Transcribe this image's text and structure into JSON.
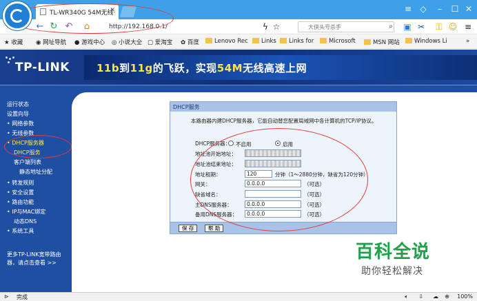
{
  "browser": {
    "tab_title": "TL-WR340G 54M无线·",
    "url": "http://192.168.0.1/",
    "search_placeholder": "大侠头号杀手",
    "status": "完成",
    "zoom": "100%",
    "bookmarks": [
      "收藏",
      "网址导航",
      "游戏中心",
      "小说大全",
      "爱淘宝",
      "百度",
      "Lenovo Rec",
      "Links",
      "Links for",
      "Microsoft",
      "MSN 网站",
      "Windows Li"
    ]
  },
  "brand": {
    "logo_text": "TP-LINK",
    "slogan_a": "11b",
    "slogan_b": "到",
    "slogan_c": "11g",
    "slogan_d": "的飞跃，实现",
    "slogan_e": "54M",
    "slogan_f": "无线高速上网"
  },
  "sidebar": {
    "items": [
      "运行状态",
      "设置向导",
      "• 网络参数",
      "• 无线参数",
      "• DHCP服务器",
      "DHCP服务",
      "客户端列表",
      "静态地址分配",
      "• 转发规则",
      "• 安全设置",
      "• 路由功能",
      "• IP与MAC绑定",
      "动态DNS",
      "• 系统工具"
    ],
    "more_line1": "更多TP-LINK宽带路由",
    "more_line2": "器，请点击查看 >>"
  },
  "panel": {
    "title": "DHCP服务",
    "intro": "本路由器内建DHCP服务器，它能自动替您配置局域网中各计算机的TCP/IP协议。",
    "dhcp_label": "DHCP服务器：",
    "off_label": "不启用",
    "on_label": "启用",
    "start_label": "地址池开始地址：",
    "end_label": "地址池结束地址：",
    "lease_label": "地址租期：",
    "lease_value": "120",
    "lease_note": "分钟（1～2880分钟，缺省为120分钟）",
    "gateway_label": "网关：",
    "gateway_value": "0.0.0.0",
    "domain_label": "缺省域名：",
    "dns1_label": "主DNS服务器：",
    "dns1_value": "0.0.0.0",
    "dns2_label": "备用DNS服务器：",
    "dns2_value": "0.0.0.0",
    "optional": "（可选）",
    "save_label": "保 存",
    "help_label": "帮 助"
  },
  "watermark": {
    "title": "百科全说",
    "subtitle": "助你轻松解决"
  },
  "colors": {
    "accent": "#3fa0e8",
    "router_blue": "#1f4fa3",
    "highlight": "#e23b3b",
    "watermark_green": "#1da24a"
  }
}
